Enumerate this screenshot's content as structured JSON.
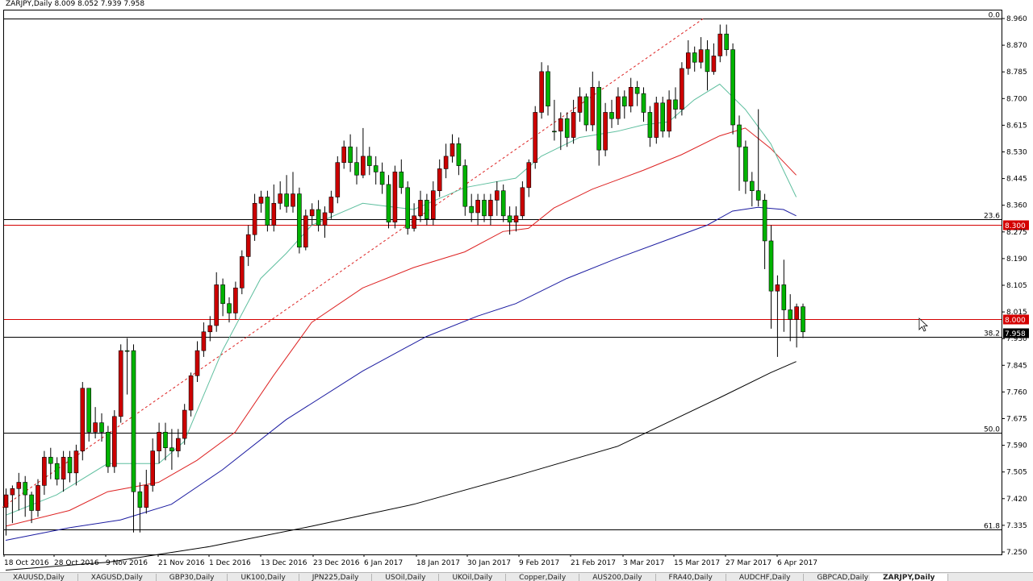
{
  "chart_data": {
    "type": "candlestick",
    "header": "ZARJPY,Daily  8.009 8.052 7.939 7.958",
    "ylim": [
      7.25,
      8.985
    ],
    "ytick_labels": [
      "8.960",
      "8.870",
      "8.785",
      "8.700",
      "8.615",
      "8.530",
      "8.445",
      "8.360",
      "8.275",
      "8.190",
      "8.105",
      "8.015",
      "7.930",
      "7.845",
      "7.760",
      "7.675",
      "7.590",
      "7.505",
      "7.420",
      "7.335",
      "7.250"
    ],
    "x_labels": [
      "18 Oct 2016",
      "28 Oct 2016",
      "9 Nov 2016",
      "21 Nov 2016",
      "1 Dec 2016",
      "13 Dec 2016",
      "23 Dec 2016",
      "6 Jan 2017",
      "18 Jan 2017",
      "30 Jan 2017",
      "9 Feb 2017",
      "21 Feb 2017",
      "3 Mar 2017",
      "15 Mar 2017",
      "27 Mar 2017",
      "6 Apr 2017"
    ],
    "fib_levels": [
      {
        "label": "0.0",
        "value": 8.96
      },
      {
        "label": "23.6",
        "value": 8.318
      },
      {
        "label": "38.2",
        "value": 7.943
      },
      {
        "label": "50.0",
        "value": 7.637
      },
      {
        "label": "61.8",
        "value": 7.33
      }
    ],
    "price_levels": [
      {
        "value": 8.3,
        "label": "8.300",
        "color": "#d40000"
      },
      {
        "value": 8.0,
        "label": "8.000",
        "color": "#d40000"
      }
    ],
    "current_price": {
      "value": 7.958,
      "label": "7.958"
    },
    "colors": {
      "bull": "#00b300",
      "bear": "#cc0000",
      "ma_fast": "#5fbf9f",
      "ma_mid": "#dd2222",
      "ma_slow": "#1a1aa0",
      "ma_long": "#000000",
      "trend": "#dd2222"
    },
    "candles": [
      [
        7.44,
        7.46,
        7.31,
        7.4
      ],
      [
        7.46,
        7.47,
        7.35,
        7.44
      ],
      [
        7.48,
        7.51,
        7.39,
        7.46
      ],
      [
        7.44,
        7.5,
        7.37,
        7.48
      ],
      [
        7.39,
        7.45,
        7.35,
        7.44
      ],
      [
        7.47,
        7.49,
        7.37,
        7.39
      ],
      [
        7.56,
        7.58,
        7.44,
        7.47
      ],
      [
        7.54,
        7.59,
        7.49,
        7.56
      ],
      [
        7.49,
        7.56,
        7.47,
        7.54
      ],
      [
        7.56,
        7.58,
        7.45,
        7.49
      ],
      [
        7.51,
        7.58,
        7.48,
        7.56
      ],
      [
        7.58,
        7.6,
        7.47,
        7.51
      ],
      [
        7.78,
        7.8,
        7.55,
        7.58
      ],
      [
        7.64,
        7.78,
        7.61,
        7.78
      ],
      [
        7.67,
        7.72,
        7.62,
        7.64
      ],
      [
        7.64,
        7.7,
        7.61,
        7.67
      ],
      [
        7.53,
        7.66,
        7.51,
        7.64
      ],
      [
        7.69,
        7.71,
        7.51,
        7.53
      ],
      [
        7.9,
        7.92,
        7.67,
        7.69
      ],
      [
        7.9,
        7.94,
        7.76,
        7.9
      ],
      [
        7.45,
        7.92,
        7.32,
        7.9
      ],
      [
        7.4,
        7.48,
        7.32,
        7.45
      ],
      [
        7.47,
        7.52,
        7.38,
        7.4
      ],
      [
        7.58,
        7.62,
        7.45,
        7.47
      ],
      [
        7.64,
        7.67,
        7.54,
        7.58
      ],
      [
        7.59,
        7.67,
        7.55,
        7.64
      ],
      [
        7.58,
        7.65,
        7.52,
        7.59
      ],
      [
        7.62,
        7.65,
        7.56,
        7.58
      ],
      [
        7.71,
        7.73,
        7.6,
        7.62
      ],
      [
        7.82,
        7.83,
        7.69,
        7.71
      ],
      [
        7.9,
        7.93,
        7.8,
        7.82
      ],
      [
        7.96,
        7.99,
        7.88,
        7.9
      ],
      [
        7.98,
        8.01,
        7.93,
        7.96
      ],
      [
        8.11,
        8.15,
        7.96,
        7.98
      ],
      [
        8.05,
        8.13,
        8.01,
        8.11
      ],
      [
        8.02,
        8.07,
        7.99,
        8.05
      ],
      [
        8.1,
        8.12,
        8.0,
        8.02
      ],
      [
        8.2,
        8.22,
        8.08,
        8.1
      ],
      [
        8.27,
        8.3,
        8.17,
        8.2
      ],
      [
        8.37,
        8.4,
        8.25,
        8.27
      ],
      [
        8.39,
        8.41,
        8.34,
        8.37
      ],
      [
        8.3,
        8.41,
        8.28,
        8.39
      ],
      [
        8.37,
        8.43,
        8.28,
        8.3
      ],
      [
        8.4,
        8.44,
        8.35,
        8.37
      ],
      [
        8.36,
        8.46,
        8.34,
        8.4
      ],
      [
        8.4,
        8.47,
        8.34,
        8.36
      ],
      [
        8.23,
        8.42,
        8.21,
        8.4
      ],
      [
        8.33,
        8.35,
        8.22,
        8.23
      ],
      [
        8.35,
        8.37,
        8.3,
        8.33
      ],
      [
        8.3,
        8.38,
        8.28,
        8.35
      ],
      [
        8.34,
        8.36,
        8.26,
        8.3
      ],
      [
        8.39,
        8.41,
        8.32,
        8.34
      ],
      [
        8.5,
        8.52,
        8.37,
        8.39
      ],
      [
        8.55,
        8.57,
        8.48,
        8.5
      ],
      [
        8.5,
        8.59,
        8.47,
        8.55
      ],
      [
        8.46,
        8.55,
        8.43,
        8.5
      ],
      [
        8.52,
        8.61,
        8.45,
        8.46
      ],
      [
        8.49,
        8.55,
        8.46,
        8.52
      ],
      [
        8.47,
        8.52,
        8.43,
        8.49
      ],
      [
        8.43,
        8.5,
        8.4,
        8.47
      ],
      [
        8.31,
        8.46,
        8.29,
        8.43
      ],
      [
        8.47,
        8.49,
        8.29,
        8.31
      ],
      [
        8.42,
        8.51,
        8.4,
        8.47
      ],
      [
        8.29,
        8.44,
        8.27,
        8.42
      ],
      [
        8.33,
        8.37,
        8.28,
        8.29
      ],
      [
        8.38,
        8.41,
        8.31,
        8.33
      ],
      [
        8.32,
        8.4,
        8.3,
        8.38
      ],
      [
        8.41,
        8.44,
        8.3,
        8.32
      ],
      [
        8.48,
        8.51,
        8.39,
        8.41
      ],
      [
        8.52,
        8.56,
        8.45,
        8.48
      ],
      [
        8.56,
        8.59,
        8.5,
        8.52
      ],
      [
        8.49,
        8.58,
        8.46,
        8.56
      ],
      [
        8.36,
        8.51,
        8.33,
        8.49
      ],
      [
        8.34,
        8.4,
        8.31,
        8.36
      ],
      [
        8.38,
        8.4,
        8.3,
        8.34
      ],
      [
        8.33,
        8.4,
        8.31,
        8.38
      ],
      [
        8.38,
        8.4,
        8.3,
        8.33
      ],
      [
        8.41,
        8.44,
        8.33,
        8.38
      ],
      [
        8.33,
        8.43,
        8.31,
        8.41
      ],
      [
        8.31,
        8.36,
        8.27,
        8.33
      ],
      [
        8.33,
        8.36,
        8.28,
        8.31
      ],
      [
        8.42,
        8.44,
        8.32,
        8.33
      ],
      [
        8.5,
        8.51,
        8.39,
        8.42
      ],
      [
        8.66,
        8.68,
        8.48,
        8.5
      ],
      [
        8.79,
        8.82,
        8.64,
        8.66
      ],
      [
        8.68,
        8.81,
        8.65,
        8.79
      ],
      [
        8.6,
        8.7,
        8.57,
        8.6
      ],
      [
        8.64,
        8.66,
        8.54,
        8.6
      ],
      [
        8.58,
        8.66,
        8.55,
        8.64
      ],
      [
        8.66,
        8.7,
        8.56,
        8.58
      ],
      [
        8.71,
        8.74,
        8.63,
        8.66
      ],
      [
        8.62,
        8.72,
        8.6,
        8.71
      ],
      [
        8.74,
        8.79,
        8.6,
        8.62
      ],
      [
        8.54,
        8.76,
        8.49,
        8.74
      ],
      [
        8.66,
        8.69,
        8.52,
        8.54
      ],
      [
        8.64,
        8.7,
        8.61,
        8.66
      ],
      [
        8.71,
        8.74,
        8.62,
        8.64
      ],
      [
        8.68,
        8.73,
        8.64,
        8.71
      ],
      [
        8.74,
        8.77,
        8.66,
        8.68
      ],
      [
        8.72,
        8.76,
        8.68,
        8.74
      ],
      [
        8.66,
        8.74,
        8.63,
        8.72
      ],
      [
        8.58,
        8.68,
        8.55,
        8.66
      ],
      [
        8.69,
        8.71,
        8.56,
        8.58
      ],
      [
        8.6,
        8.71,
        8.58,
        8.69
      ],
      [
        8.7,
        8.73,
        8.58,
        8.6
      ],
      [
        8.67,
        8.74,
        8.64,
        8.7
      ],
      [
        8.8,
        8.82,
        8.65,
        8.67
      ],
      [
        8.85,
        8.89,
        8.78,
        8.8
      ],
      [
        8.82,
        8.87,
        8.79,
        8.85
      ],
      [
        8.86,
        8.9,
        8.8,
        8.82
      ],
      [
        8.79,
        8.89,
        8.73,
        8.86
      ],
      [
        8.84,
        8.88,
        8.78,
        8.79
      ],
      [
        8.91,
        8.94,
        8.82,
        8.84
      ],
      [
        8.86,
        8.94,
        8.84,
        8.91
      ],
      [
        8.62,
        8.88,
        8.59,
        8.86
      ],
      [
        8.55,
        8.65,
        8.41,
        8.62
      ],
      [
        8.44,
        8.57,
        8.4,
        8.55
      ],
      [
        8.41,
        8.47,
        8.36,
        8.44
      ],
      [
        8.38,
        8.67,
        8.36,
        8.41
      ],
      [
        8.25,
        8.4,
        8.16,
        8.38
      ],
      [
        8.09,
        8.3,
        7.97,
        8.25
      ],
      [
        8.11,
        8.14,
        7.88,
        8.09
      ],
      [
        8.03,
        8.19,
        7.96,
        8.11
      ],
      [
        8.0,
        8.08,
        7.93,
        8.03
      ],
      [
        8.04,
        8.05,
        7.91,
        8.0
      ],
      [
        7.96,
        8.05,
        7.94,
        8.04
      ]
    ],
    "ma_fast": [
      [
        0,
        7.375
      ],
      [
        8,
        7.44
      ],
      [
        16,
        7.54
      ],
      [
        24,
        7.54
      ],
      [
        28,
        7.61
      ],
      [
        34,
        7.9
      ],
      [
        40,
        8.13
      ],
      [
        44,
        8.21
      ],
      [
        48,
        8.3
      ],
      [
        56,
        8.37
      ],
      [
        64,
        8.35
      ],
      [
        72,
        8.42
      ],
      [
        80,
        8.45
      ],
      [
        84,
        8.52
      ],
      [
        90,
        8.58
      ],
      [
        96,
        8.6
      ],
      [
        100,
        8.62
      ],
      [
        104,
        8.63
      ],
      [
        108,
        8.7
      ],
      [
        112,
        8.75
      ],
      [
        116,
        8.67
      ],
      [
        120,
        8.56
      ],
      [
        124,
        8.39
      ]
    ],
    "ma_mid": [
      [
        0,
        7.34
      ],
      [
        10,
        7.39
      ],
      [
        16,
        7.45
      ],
      [
        24,
        7.48
      ],
      [
        30,
        7.55
      ],
      [
        36,
        7.64
      ],
      [
        42,
        7.82
      ],
      [
        48,
        7.99
      ],
      [
        56,
        8.1
      ],
      [
        64,
        8.165
      ],
      [
        72,
        8.215
      ],
      [
        78,
        8.28
      ],
      [
        82,
        8.29
      ],
      [
        86,
        8.355
      ],
      [
        92,
        8.415
      ],
      [
        100,
        8.475
      ],
      [
        106,
        8.525
      ],
      [
        112,
        8.585
      ],
      [
        116,
        8.61
      ],
      [
        120,
        8.545
      ],
      [
        124,
        8.46
      ]
    ],
    "ma_slow": [
      [
        0,
        7.295
      ],
      [
        10,
        7.335
      ],
      [
        18,
        7.36
      ],
      [
        26,
        7.41
      ],
      [
        34,
        7.52
      ],
      [
        44,
        7.68
      ],
      [
        56,
        7.835
      ],
      [
        66,
        7.945
      ],
      [
        74,
        8.01
      ],
      [
        80,
        8.05
      ],
      [
        88,
        8.13
      ],
      [
        96,
        8.195
      ],
      [
        104,
        8.255
      ],
      [
        110,
        8.3
      ],
      [
        114,
        8.345
      ],
      [
        118,
        8.357
      ],
      [
        122,
        8.35
      ],
      [
        124,
        8.33
      ]
    ],
    "ma_long": [
      [
        0,
        7.2
      ],
      [
        16,
        7.225
      ],
      [
        32,
        7.275
      ],
      [
        48,
        7.34
      ],
      [
        64,
        7.41
      ],
      [
        80,
        7.5
      ],
      [
        96,
        7.595
      ],
      [
        112,
        7.75
      ],
      [
        120,
        7.83
      ],
      [
        124,
        7.865
      ]
    ]
  },
  "tabs": {
    "left": [
      "XAUUSD,Daily",
      "XAGUSD,Daily",
      "GBP30,Daily",
      "UK100,Daily",
      "JPN225,Daily",
      "USOil,Daily",
      "UKOil,Daily",
      "Copper,Daily",
      "AUS200,Daily",
      "FRA40,Daily",
      "AUDCHF,Daily",
      "GBPCAD,Daily"
    ],
    "right": [
      "ZARJPY,Daily"
    ]
  }
}
